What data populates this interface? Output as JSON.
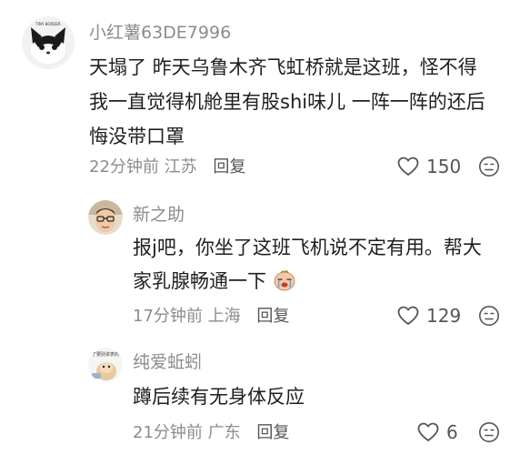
{
  "comments": [
    {
      "username": "小红薯63DE7996",
      "avatar_text": "TINY BORDER",
      "lines": [
        "天塌了 昨天乌鲁木齐飞虹桥就是这班，怪不得",
        "我一直觉得机舱里有股shi味儿 一阵一阵的还后",
        "悔没带口罩"
      ],
      "time": "22分钟前",
      "location": "江苏",
      "reply_label": "回复",
      "likes": "150",
      "like_icon": "heart-outline-icon",
      "dislike_icon": "dislike-face-icon"
    },
    {
      "username": "新之助",
      "lines": [
        "报j吧，你坐了这班飞机说不定有用。帮大",
        "家乳腺畅通一下"
      ],
      "emoji": "crying-face-emoji",
      "time": "17分钟前",
      "location": "上海",
      "reply_label": "回复",
      "likes": "129",
      "like_icon": "heart-outline-icon",
      "dislike_icon": "dislike-face-icon"
    },
    {
      "username": "纯爱蚯蚓",
      "avatar_text": "了要别讲表的",
      "lines": [
        "蹲后续有无身体反应"
      ],
      "time": "21分钟前",
      "location": "广东",
      "reply_label": "回复",
      "likes": "6",
      "like_icon": "heart-outline-icon",
      "dislike_icon": "dislike-face-icon"
    }
  ],
  "colors": {
    "secondary_text": "#8c8c8c",
    "primary_text": "#1f1f1f",
    "icon": "#555555"
  }
}
